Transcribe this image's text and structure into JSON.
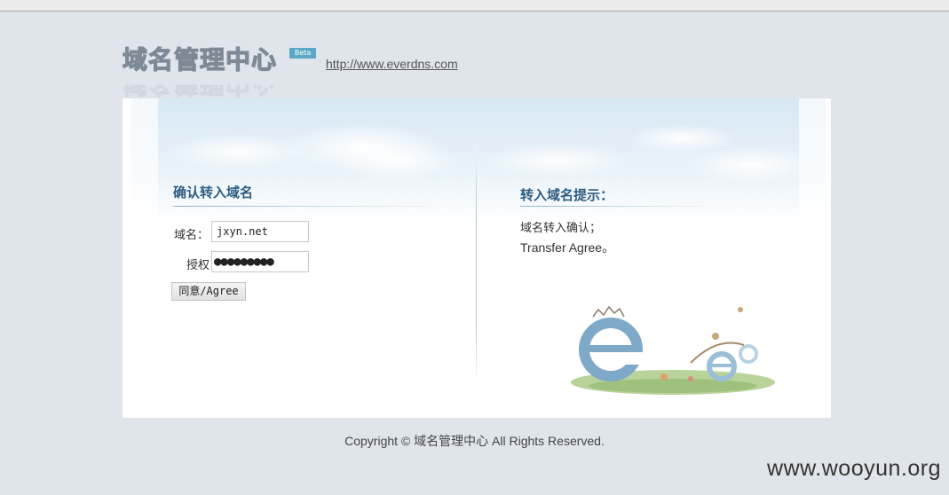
{
  "header": {
    "logo_text": "域名管理中心",
    "beta_badge": "Beta",
    "site_link": "http://www.everdns.com"
  },
  "transfer_form": {
    "heading": "确认转入域名",
    "domain_label": "域名：",
    "domain_value": "jxyn.net",
    "auth_label": "授权",
    "auth_value": "●●●●●●●●●",
    "submit_label": "同意/Agree"
  },
  "tips": {
    "heading": "转入域名提示：",
    "lines": [
      "域名转入确认；",
      "Transfer Agree。"
    ]
  },
  "footer": {
    "copyright": "Copyright © 域名管理中心 All Rights Reserved."
  },
  "watermark": "www.wooyun.org",
  "colors": {
    "page_bg": "#dfe5ea",
    "heading": "#2d5d82",
    "badge": "#5ba8c4"
  }
}
